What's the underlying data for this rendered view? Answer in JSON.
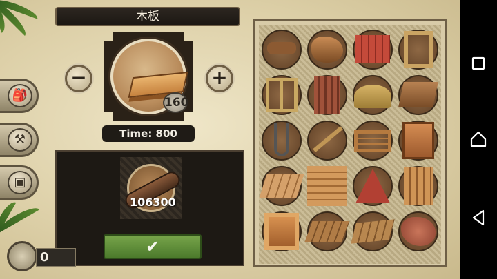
{
  "title": "木板",
  "item": {
    "name": "plank",
    "quantity": "160"
  },
  "time_label": "Time: 800",
  "resource": {
    "name": "log",
    "count": "106300"
  },
  "controls": {
    "decrease": "−",
    "increase": "+",
    "confirm": "✔"
  },
  "side_buttons": [
    {
      "name": "backpack",
      "glyph": "🎒"
    },
    {
      "name": "crafting",
      "glyph": "⚒"
    },
    {
      "name": "chest",
      "glyph": "▣"
    }
  ],
  "bottom_counter": "0",
  "grid_items": [
    "tools",
    "wood-pile",
    "roof-tiles",
    "door-frame",
    "window-frame",
    "curtain",
    "hay",
    "floor-board",
    "fishing-hook",
    "fishing-rod",
    "bed-frame",
    "wood-door",
    "wood-floor",
    "wood-wall",
    "tent",
    "wood-gate",
    "wood-window",
    "stair-board",
    "ramp-board",
    "leather"
  ],
  "colors": {
    "panel": "#d8cba8",
    "title_bg": "#1c1813",
    "confirm": "#5e8e38"
  }
}
